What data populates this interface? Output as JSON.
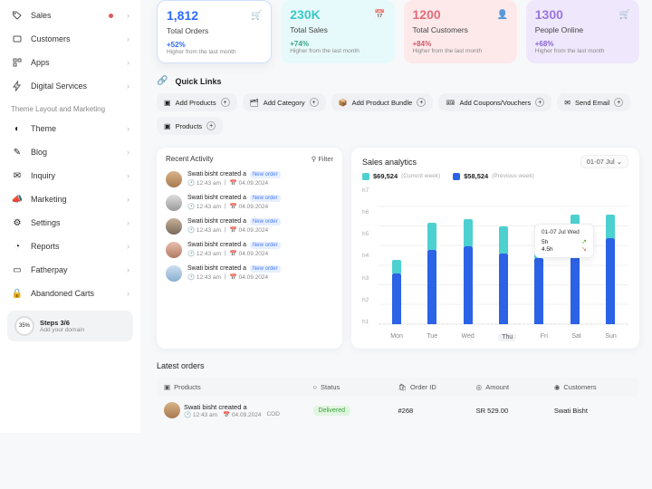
{
  "sidebar": {
    "section1": [
      {
        "label": "Sales",
        "icon": "tag"
      },
      {
        "label": "Customers",
        "icon": "users"
      },
      {
        "label": "Apps",
        "icon": "grid"
      },
      {
        "label": "Digital Services",
        "icon": "lightning"
      }
    ],
    "section2_title": "Theme Layout and Marketing",
    "section2": [
      {
        "label": "Theme",
        "icon": "palette"
      },
      {
        "label": "Blog",
        "icon": "pencil"
      },
      {
        "label": "Inquiry",
        "icon": "chat"
      },
      {
        "label": "Marketing",
        "icon": "megaphone"
      },
      {
        "label": "Settings",
        "icon": "gear"
      },
      {
        "label": "Reports",
        "icon": "clock"
      },
      {
        "label": "Fatherpay",
        "icon": "wallet"
      },
      {
        "label": "Abandoned Carts",
        "icon": "lock"
      }
    ],
    "steps": {
      "ring": "35%",
      "title": "Steps 3/6",
      "sub": "Add your domain"
    }
  },
  "stats": [
    {
      "value": "1,812",
      "title": "Total Orders",
      "pct": "+52%",
      "note": "Higher from the last month"
    },
    {
      "value": "230K",
      "title": "Total Sales",
      "pct": "+74%",
      "note": "Higher from the last month"
    },
    {
      "value": "1200",
      "title": "Total Customers",
      "pct": "+84%",
      "note": "Higher from the last month"
    },
    {
      "value": "1300",
      "title": "People Online",
      "pct": "+68%",
      "note": "Higher from the last month"
    }
  ],
  "quick": {
    "title": "Quick Links",
    "chips": [
      {
        "label": "Add Products"
      },
      {
        "label": "Add Category"
      },
      {
        "label": "Add Product Bundle"
      },
      {
        "label": "Add Coupons/Vouchers"
      },
      {
        "label": "Send Email"
      },
      {
        "label": "Products"
      }
    ]
  },
  "activity": {
    "title": "Recent Activity",
    "filter": "Filter",
    "items": [
      {
        "who": "Swati bisht created a",
        "badge": "New order",
        "time": "12:43 am",
        "date": "04.09.2024"
      },
      {
        "who": "Swati bisht created a",
        "badge": "New order",
        "time": "12:43 am",
        "date": "04.09.2024"
      },
      {
        "who": "Swati bisht created a",
        "badge": "New order",
        "time": "12:43 am",
        "date": "04.09.2024"
      },
      {
        "who": "Swati bisht created a",
        "badge": "New order",
        "time": "12:43 am",
        "date": "04.09.2024"
      },
      {
        "who": "Swati bisht created a",
        "badge": "New order",
        "time": "12:43 am",
        "date": "04.09.2024"
      }
    ]
  },
  "analytics": {
    "title": "Sales analytics",
    "range": "01-07 Jul",
    "curr_value": "$69,524",
    "curr_label": "(Current week)",
    "prev_value": "$58,524",
    "prev_label": "(Previous week)",
    "tooltip": {
      "head": "01-07 Jul Wed",
      "r1": "5h",
      "r2": "4.5h"
    }
  },
  "chart_data": {
    "type": "bar",
    "categories": [
      "Mon",
      "Tue",
      "Wed",
      "Thu",
      "Fri",
      "Sat",
      "Sun"
    ],
    "series": [
      {
        "name": "Current week",
        "values": [
          3.3,
          5.2,
          5.4,
          5.0,
          5.0,
          5.6,
          5.6
        ]
      },
      {
        "name": "Previous week",
        "values": [
          2.6,
          3.8,
          4.0,
          3.6,
          3.4,
          3.8,
          4.4
        ]
      }
    ],
    "ylabels": [
      "h7",
      "h6",
      "h5",
      "h4",
      "h3",
      "h2",
      "h1"
    ],
    "ylim": [
      0,
      7
    ],
    "selected": "Thu"
  },
  "orders": {
    "title": "Latest orders",
    "cols": {
      "products": "Products",
      "status": "Status",
      "order": "Order ID",
      "amount": "Amount",
      "customers": "Customers"
    },
    "rows": [
      {
        "name": "Swati bisht created a",
        "time": "12:43 am",
        "date": "04.09.2024",
        "extra": "COD",
        "status": "Delivered",
        "oid": "#268",
        "amount": "SR 529.00",
        "cust": "Swati Bisht"
      }
    ]
  }
}
